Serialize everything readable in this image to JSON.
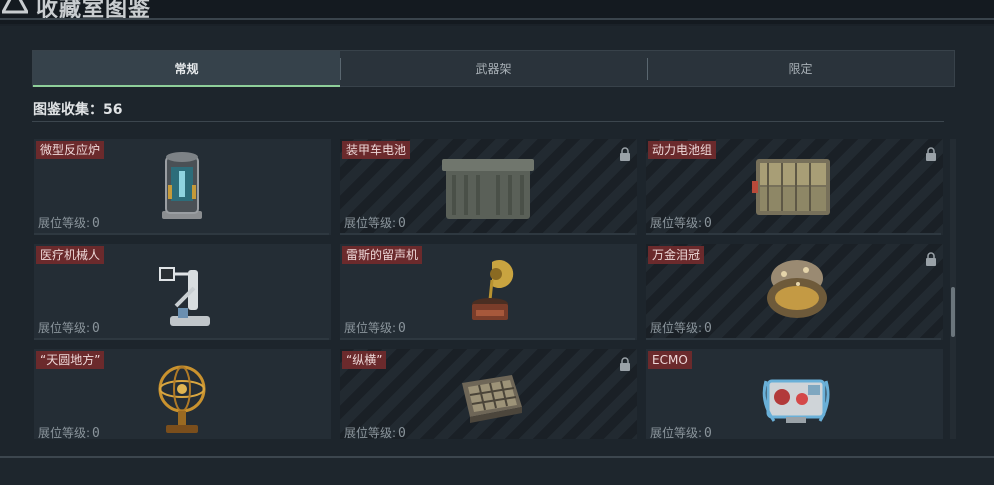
{
  "header": {
    "title": "收藏室图鉴"
  },
  "tabs": [
    {
      "label": "常规",
      "active": true
    },
    {
      "label": "武器架",
      "active": false
    },
    {
      "label": "限定",
      "active": false
    }
  ],
  "collection": {
    "count_label": "图鉴收集：56"
  },
  "level_label": "展位等级:",
  "colors": {
    "accent": "#8fcf9a",
    "label_bg": "#6b2a2c"
  },
  "items": [
    {
      "name": "微型反应炉",
      "level": "0",
      "locked": false,
      "icon": "reactor-icon"
    },
    {
      "name": "装甲车电池",
      "level": "0",
      "locked": true,
      "icon": "battery-icon"
    },
    {
      "name": "动力电池组",
      "level": "0",
      "locked": true,
      "icon": "battery-pack-icon"
    },
    {
      "name": "医疗机械人",
      "level": "0",
      "locked": false,
      "icon": "medical-robot-icon"
    },
    {
      "name": "雷斯的留声机",
      "level": "0",
      "locked": false,
      "icon": "gramophone-icon"
    },
    {
      "name": "万金泪冠",
      "level": "0",
      "locked": true,
      "icon": "jeweled-egg-icon"
    },
    {
      "name": "“天圆地方”",
      "level": "0",
      "locked": false,
      "icon": "armillary-sphere-icon"
    },
    {
      "name": "“纵横”",
      "level": "0",
      "locked": true,
      "icon": "chessboard-icon"
    },
    {
      "name": "ECMO",
      "level": "0",
      "locked": false,
      "icon": "ecmo-machine-icon"
    }
  ]
}
